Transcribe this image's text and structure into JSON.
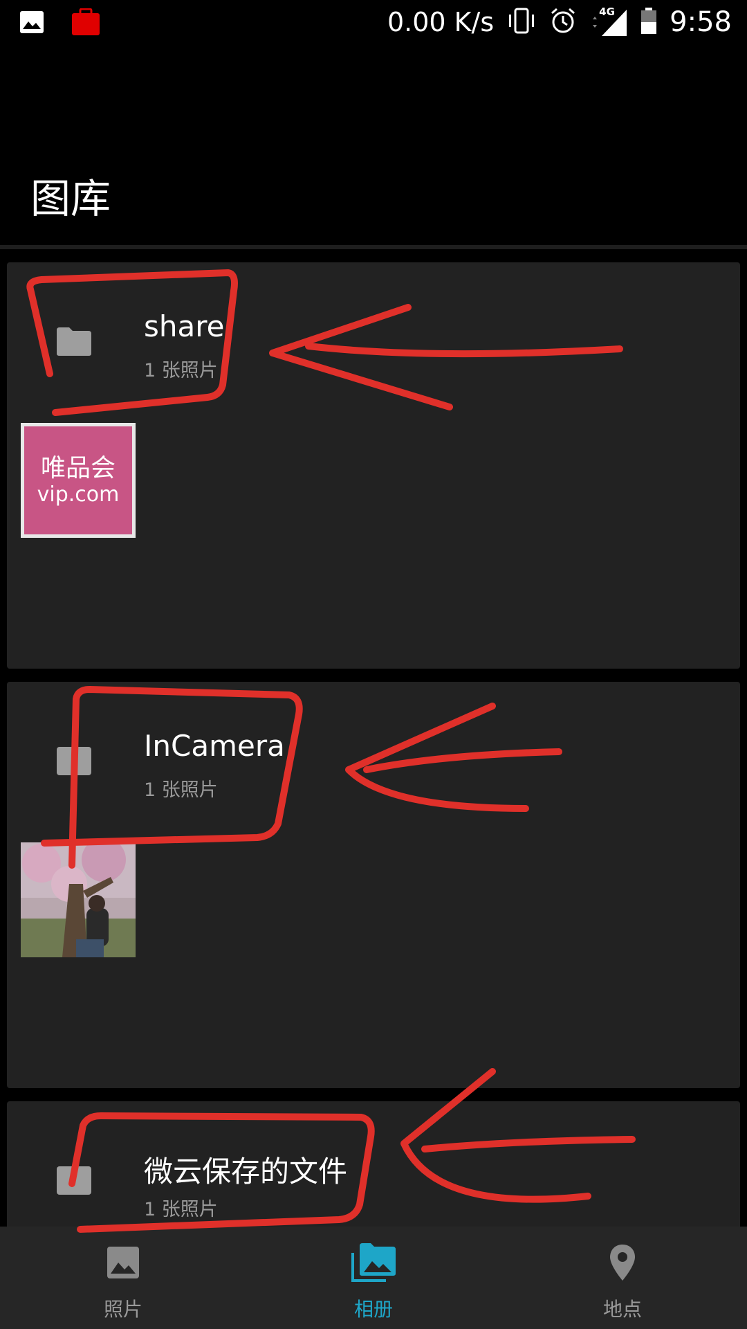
{
  "status_bar": {
    "net_speed": "0.00 K/s",
    "network": "4G",
    "time": "9:58"
  },
  "app": {
    "title": "图库"
  },
  "albums": [
    {
      "name": "share",
      "count": "1 张照片",
      "thumbnail": {
        "line1": "唯品会",
        "line2": "vip.com"
      }
    },
    {
      "name": "InCamera",
      "count": "1 张照片"
    },
    {
      "name": "微云保存的文件",
      "count": "1 张照片"
    }
  ],
  "bottom_nav": {
    "items": [
      {
        "label": "照片",
        "icon": "photo-icon"
      },
      {
        "label": "相册",
        "icon": "albums-icon",
        "active": true
      },
      {
        "label": "地点",
        "icon": "location-pin-icon"
      }
    ]
  },
  "colors": {
    "accent": "#1ea6c8",
    "card": "#222222",
    "annotation": "#e0302a"
  }
}
